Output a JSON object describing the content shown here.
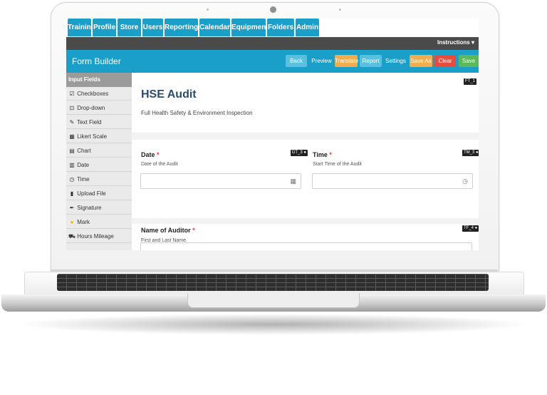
{
  "nav": {
    "tabs": [
      "Training",
      "Profile",
      "Store",
      "Users",
      "Reporting",
      "Calendar",
      "Equipment",
      "Folders",
      "Admin"
    ]
  },
  "instructions": {
    "label": "Instructions ▾"
  },
  "form_builder": {
    "title": "Form Builder",
    "buttons": [
      {
        "label": "Back",
        "color": "#5bc0de"
      },
      {
        "label": "Preview",
        "color": "#1a9fc9"
      },
      {
        "label": "Translate",
        "color": "#f0ad4e"
      },
      {
        "label": "Report",
        "color": "#5bc0de"
      },
      {
        "label": "Settings",
        "color": "#1a9fc9"
      },
      {
        "label": "Save As",
        "color": "#f0ad4e"
      },
      {
        "label": "Clear",
        "color": "#e74c3c"
      },
      {
        "label": "Save",
        "color": "#5cb85c"
      }
    ]
  },
  "sidebar": {
    "heading": "Input Fields",
    "items": [
      {
        "label": "Checkboxes",
        "icon": "checkbox-icon"
      },
      {
        "label": "Drop-down",
        "icon": "dropdown-icon"
      },
      {
        "label": "Text Field",
        "icon": "edit-icon"
      },
      {
        "label": "Likert Scale",
        "icon": "grid-icon"
      },
      {
        "label": "Chart",
        "icon": "table-icon"
      },
      {
        "label": "Date",
        "icon": "calendar-icon"
      },
      {
        "label": "Time",
        "icon": "clock-icon"
      },
      {
        "label": "Upload File",
        "icon": "file-icon"
      },
      {
        "label": "Signature",
        "icon": "pen-icon"
      },
      {
        "label": "Mark",
        "icon": "circle-icon"
      },
      {
        "label": "Hours Mileage",
        "icon": "truck-icon"
      }
    ]
  },
  "form": {
    "tag": "FT_1",
    "title": "HSE Audit",
    "subtitle": "Full Health Safety & Environment Inspection",
    "date": {
      "label": "Date",
      "required": "*",
      "hint": "Date of the Audit",
      "tag": "DT_3"
    },
    "time": {
      "label": "Time",
      "required": "*",
      "hint": "Start Time of the Audit",
      "tag": "TM_3"
    },
    "auditor": {
      "label": "Name of Auditor",
      "required": "*",
      "hint": "First and Last Name",
      "tag": "TF_4"
    }
  }
}
